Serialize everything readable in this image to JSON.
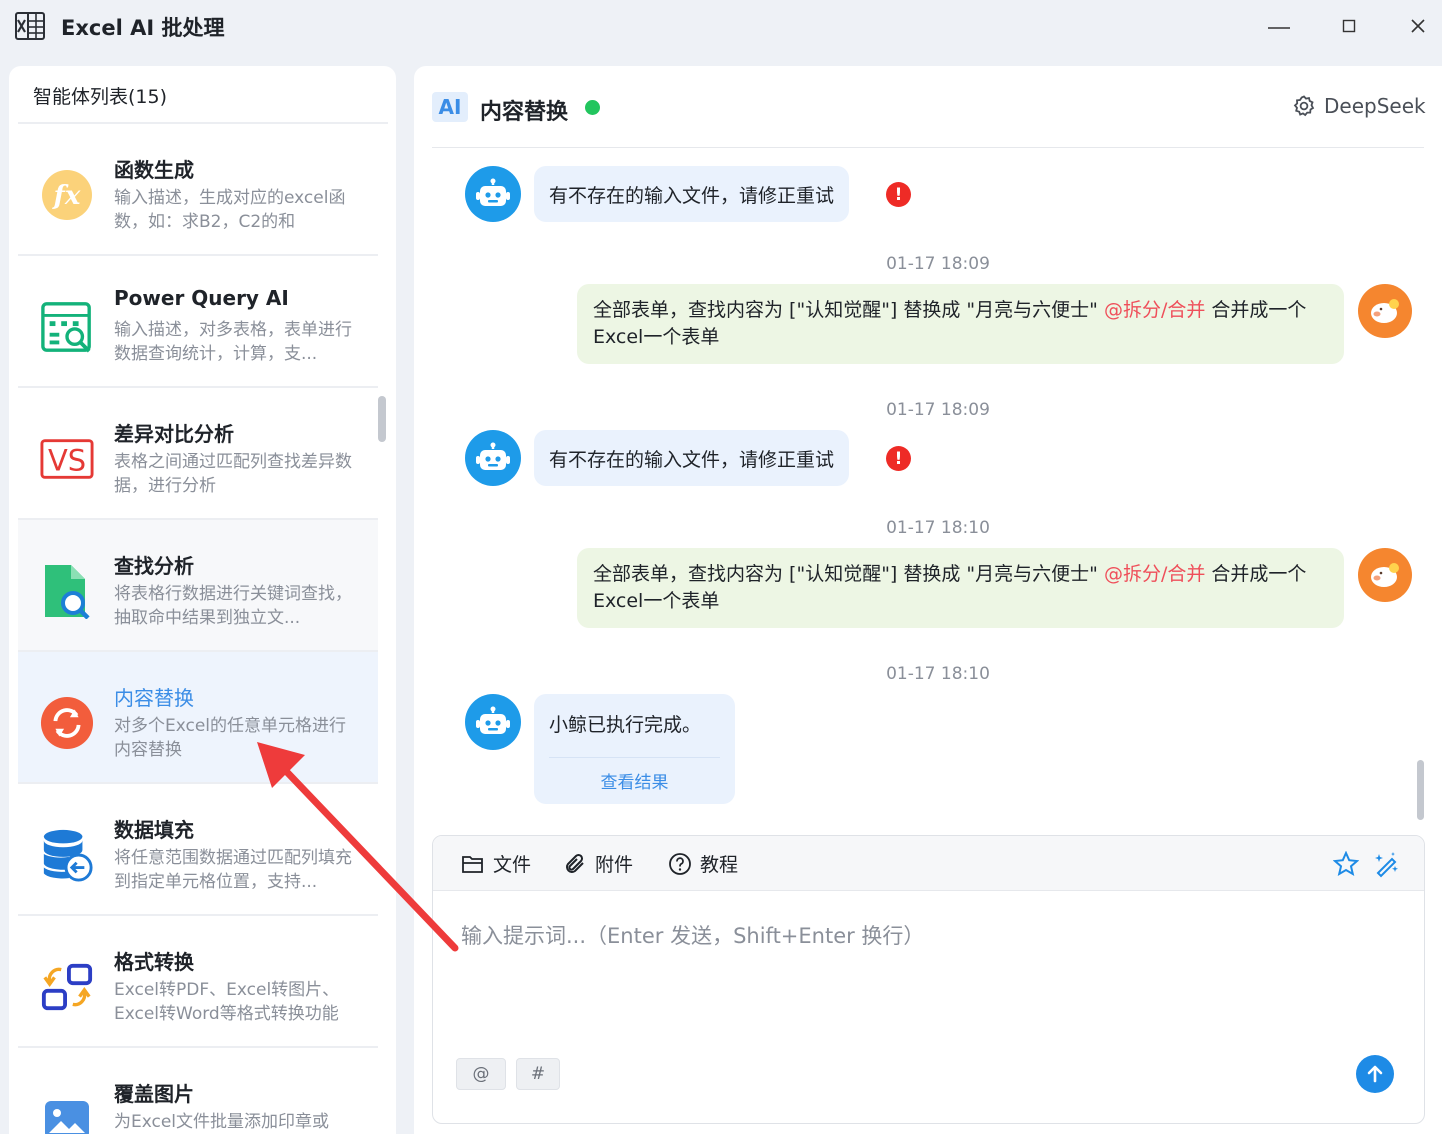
{
  "window": {
    "title": "Excel AI 批处理",
    "icon": "excel-icon"
  },
  "sidebar": {
    "header": "智能体列表(15)",
    "items": [
      {
        "name": "函数生成",
        "desc": "输入描述，生成对应的excel函数，如：求B2，C2的和",
        "icon": "fx-icon"
      },
      {
        "name": "Power Query AI",
        "desc": "输入描述，对多表格，表单进行数据查询统计，计算，支...",
        "icon": "power-query-icon"
      },
      {
        "name": "差异对比分析",
        "desc": "表格之间通过匹配列查找差异数据，进行分析",
        "icon": "vs-icon"
      },
      {
        "name": "查找分析",
        "desc": "将表格行数据进行关键词查找，抽取命中结果到独立文...",
        "icon": "file-search-icon"
      },
      {
        "name": "内容替换",
        "desc": "对多个Excel的任意单元格进行内容替换",
        "icon": "replace-icon"
      },
      {
        "name": "数据填充",
        "desc": "将任意范围数据通过匹配列填充到指定单元格位置，支持...",
        "icon": "database-fill-icon"
      },
      {
        "name": "格式转换",
        "desc": "Excel转PDF、Excel转图片、Excel转Word等格式转换功能",
        "icon": "format-convert-icon"
      },
      {
        "name": "覆盖图片",
        "desc": "为Excel文件批量添加印章或",
        "icon": "image-icon"
      }
    ]
  },
  "chat": {
    "badge": "AI",
    "title": "内容替换",
    "status_color": "#22c55e",
    "model": "DeepSeek",
    "messages": [
      {
        "role": "bot",
        "text": "有不存在的输入文件，请修正重试"
      },
      {
        "role": "time",
        "text": "01-17 18:09"
      },
      {
        "role": "user",
        "text_before": "全部表单，查找内容为 [\"认知觉醒\"] 替换成 \"月亮与六便士\" ",
        "mention": "@拆分/合并",
        "text_after": " 合并成一个Excel一个表单"
      },
      {
        "role": "time",
        "text": "01-17 18:09"
      },
      {
        "role": "bot",
        "text": "有不存在的输入文件，请修正重试"
      },
      {
        "role": "time",
        "text": "01-17 18:10"
      },
      {
        "role": "user",
        "text_before": "全部表单，查找内容为 [\"认知觉醒\"] 替换成 \"月亮与六便士\" ",
        "mention": "@拆分/合并",
        "text_after": " 合并成一个Excel一个表单"
      },
      {
        "role": "time",
        "text": "01-17 18:10"
      },
      {
        "role": "bot",
        "text": "小鲸已执行完成。",
        "link": "查看结果"
      }
    ],
    "error_mark": "!"
  },
  "composer": {
    "file_label": "文件",
    "attach_label": "附件",
    "tutorial_label": "教程",
    "placeholder": "输入提示词...（Enter 发送，Shift+Enter 换行）",
    "at_label": "@",
    "hash_label": "#"
  },
  "colors": {
    "accent": "#3b8de6",
    "bot_bubble": "#eaf2fd",
    "user_bubble": "#edf6e4",
    "mention": "#ef4f5a",
    "annotation_arrow": "#ee3b3b"
  }
}
